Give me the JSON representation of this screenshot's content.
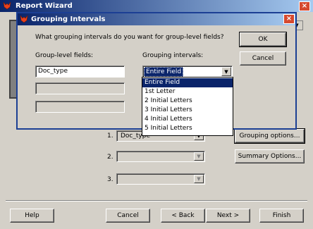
{
  "wizard": {
    "title": "Report Wizard",
    "group_rows": [
      {
        "num": "1.",
        "value": "Doc_type"
      },
      {
        "num": "2.",
        "value": ""
      },
      {
        "num": "3.",
        "value": ""
      }
    ],
    "grouping_options_label": "Grouping options...",
    "summary_options_label": "Summary Options...",
    "help_label": "Help",
    "cancel_label": "Cancel",
    "back_label": "< Back",
    "next_label": "Next >",
    "finish_label": "Finish"
  },
  "dialog": {
    "title": "Grouping Intervals",
    "question": "What grouping intervals do you want for group-level fields?",
    "fields_header": "Group-level fields:",
    "intervals_header": "Grouping intervals:",
    "field_rows": [
      "Doc_type",
      "",
      ""
    ],
    "selected_interval": "Entire Field",
    "interval_options": [
      "Entire Field",
      "1st Letter",
      "2 Initial Letters",
      "3 Initial Letters",
      "4 Initial Letters",
      "5 Initial Letters"
    ],
    "selected_index": 0,
    "ok_label": "OK",
    "cancel_label": "Cancel"
  },
  "colors": {
    "titlebar_start": "#0a246a",
    "titlebar_end": "#a6caf0",
    "selection": "#0a246a",
    "close_button": "#d6492e",
    "frame_border": "#1c3f94"
  }
}
